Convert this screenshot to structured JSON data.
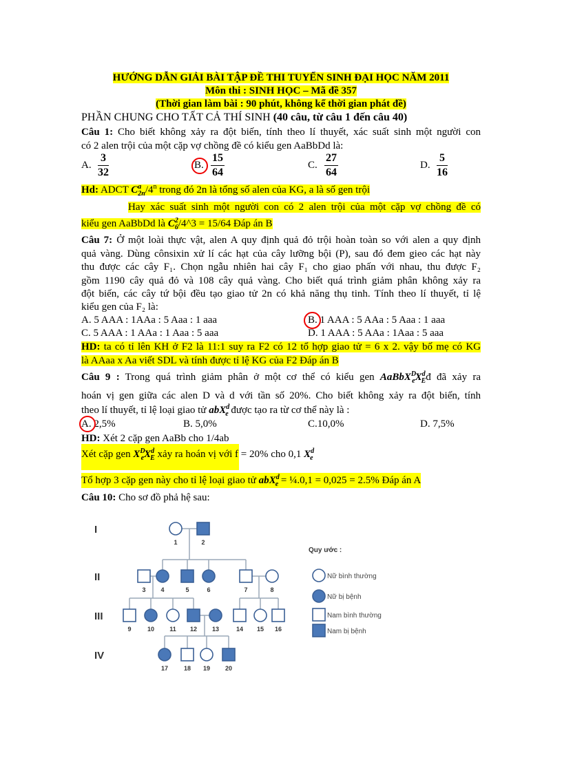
{
  "header": {
    "title": "HƯỚNG DẪN GIẢI BÀI TẬP  ĐỀ THI TUYỂN SINH ĐẠI HỌC  NĂM 2011",
    "subject": "Môn thi : SINH HỌC – Mã đề 357",
    "time": "(Thời gian làm bài : 90 phút, không kể thời gian phát đề)",
    "section": "PHẦN CHUNG CHO TẤT CẢ THÍ SINH",
    "section_note": "(40 câu, từ câu 1 đến câu 40)"
  },
  "q1": {
    "label": "Câu 1:",
    "text1": " Cho biết không xảy ra đột biến, tính theo lí thuyết, xác suất sinh một người con",
    "text2": "có 2 alen trội của một cặp vợ chồng đề có kiểu gen AaBbDd là:",
    "options": [
      {
        "letter": "A.",
        "num": "3",
        "den": "32"
      },
      {
        "letter": "B.",
        "num": "15",
        "den": "64"
      },
      {
        "letter": "C.",
        "num": "27",
        "den": "64"
      },
      {
        "letter": "D.",
        "num": "5",
        "den": "16"
      }
    ],
    "hd_label": "Hd:",
    "hd1a": " ADCT   ",
    "hd1_C": "C",
    "hd1_sup": "a",
    "hd1_sub": "2n",
    "hd1b": "/4",
    "hd1_supn": "n",
    "hd1c": " trong đó 2n là tổng số alen của KG, a là số gen trội",
    "hd2": "Hay xác suất sinh một người con có 2 alen trội của một cặp vợ chồng đề có",
    "hd3a": "kiểu gen AaBbDd là ",
    "hd3_C": "C",
    "hd3_sup": "2",
    "hd3_sub": "6",
    "hd3b": "/4^3 = 15/64 Đáp án B"
  },
  "q7": {
    "label": "Câu 7:",
    "lines": [
      " Ở một loài thực vật, alen A quy định quả đỏ trội hoàn toàn so với alen a quy định",
      "quả vàng. Dùng cônsixin  xử lí các hạt của cây lưỡng bội (P), sau đó đem gieo các hạt này",
      "thu được các cây F₁. Chọn ngẫu nhiên hai cây F₁ cho giao phấn với nhau, thu được F₂",
      "gồm 1190 cây quả đỏ và 108 cây quả vàng. Cho biết quá trình giảm phân không xảy ra",
      "đột biến, các cây tứ bội đều tạo giao tử 2n có khả năng thụ tinh. Tính theo lí thuyết, tỉ lệ",
      "kiểu gen của F₂ là:"
    ],
    "options": [
      "A. 5 AAA : 1AAa : 5 Aaa : 1 aaa",
      "B. 1 AAA : 5 AAa : 5 Aaa : 1 aaa",
      "C. 5 AAA : 1 AAa : 1 Aaa : 5 aaa",
      "D. 1 AAA : 5 AAa : 1Aaa : 5 aaa"
    ],
    "hd_label": "HD:",
    "hd1": " ta có tỉ lên KH ở F2 là 11:1 suy ra F2 có 12 tổ hợp giao tử = 6 x 2. vậy bố mẹ có KG",
    "hd2": "là     AAaa x Aa viết SDL và tính  được tỉ lệ KG của F2 Đáp án B"
  },
  "q9": {
    "label": "Câu 9 :",
    "l1a": " Trong quá trình giảm phân ở một cơ thể có kiểu gen ",
    "genotype": "AaBbX",
    "g_sup1": "D",
    "g_sub1": "e",
    "g_X2": "X",
    "g_sup2": "d",
    "g_sub2": "E",
    "l1b": "đ đã xảy ra",
    "l2": "hoán vị gen giữa các alen D và d với tần số 20%. Cho biết không xảy ra đột biến, tính",
    "l3a": "theo lí thuyết, tỉ lệ loại giao tử ",
    "gam": "abX",
    "gam_sup": "d",
    "gam_sub": "e",
    "l3b": " được tạo ra từ cơ thể này là :",
    "options": [
      "A. 2,5%",
      "B. 5,0%",
      "C.10,0%",
      "D. 7,5%"
    ],
    "hd_label": "HD:",
    "hd1": " Xét 2 cặp gen AaBb cho 1/4ab",
    "hd2a": "Xét cặp gen  ",
    "hd2b": " xảy ra hoán vị với f = 20%  cho 0,1 ",
    "hd3a": "Tổ hợp 3 cặp gen này cho tỉ lệ loại giao tử ",
    "hd3b": " = ¼.0,1 = 0,025 = 2.5% Đáp án A"
  },
  "q10": {
    "label": "Câu 10:",
    "text": " Cho sơ đồ phả hệ sau:"
  },
  "pedigree": {
    "generations": [
      "I",
      "II",
      "III",
      "IV"
    ],
    "individuals": [
      {
        "id": "1",
        "sex": "female",
        "affected": false
      },
      {
        "id": "2",
        "sex": "male",
        "affected": true
      },
      {
        "id": "3",
        "sex": "male",
        "affected": false
      },
      {
        "id": "4",
        "sex": "female",
        "affected": true
      },
      {
        "id": "5",
        "sex": "male",
        "affected": true
      },
      {
        "id": "6",
        "sex": "female",
        "affected": true
      },
      {
        "id": "7",
        "sex": "male",
        "affected": false
      },
      {
        "id": "8",
        "sex": "female",
        "affected": false
      },
      {
        "id": "9",
        "sex": "male",
        "affected": false
      },
      {
        "id": "10",
        "sex": "female",
        "affected": true
      },
      {
        "id": "11",
        "sex": "female",
        "affected": false
      },
      {
        "id": "12",
        "sex": "male",
        "affected": true
      },
      {
        "id": "13",
        "sex": "female",
        "affected": true
      },
      {
        "id": "14",
        "sex": "male",
        "affected": false
      },
      {
        "id": "15",
        "sex": "female",
        "affected": false
      },
      {
        "id": "16",
        "sex": "male",
        "affected": false
      },
      {
        "id": "17",
        "sex": "female",
        "affected": true
      },
      {
        "id": "18",
        "sex": "male",
        "affected": false
      },
      {
        "id": "19",
        "sex": "female",
        "affected": false
      },
      {
        "id": "20",
        "sex": "male",
        "affected": true
      }
    ],
    "legend_title": "Quy ước :",
    "legend": [
      {
        "label": "Nữ bình thường",
        "sex": "female",
        "affected": false
      },
      {
        "label": "Nữ bị bệnh",
        "sex": "female",
        "affected": true
      },
      {
        "label": "Nam bình thường",
        "sex": "male",
        "affected": false
      },
      {
        "label": "Nam bị bệnh",
        "sex": "male",
        "affected": true
      }
    ],
    "colors": {
      "fill": "#4a78b8",
      "stroke": "#3a5f95",
      "line": "#9aa8b8"
    }
  },
  "colors": {
    "highlight": "#ffff00",
    "answer_circle": "#e00000"
  }
}
